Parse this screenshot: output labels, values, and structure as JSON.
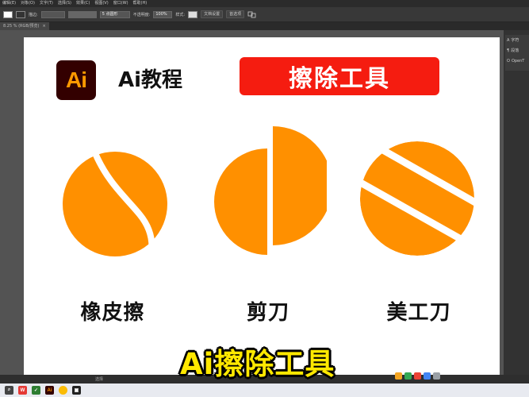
{
  "app": {
    "menu": [
      "编辑(E)",
      "对象(O)",
      "文字(T)",
      "选择(S)",
      "效果(C)",
      "视图(V)",
      "窗口(W)",
      "帮助(H)"
    ],
    "control_bar": {
      "stroke_label": "描边:",
      "stroke_value": "",
      "brush_value": "",
      "points_label": "5 点圆形",
      "opacity_label": "不透明度:",
      "opacity_value": "100%",
      "style_label": "样式:",
      "doc_setup": "文档设置",
      "prefs": "首选项"
    },
    "tab": {
      "label": "8.25 % (RGB/预览)",
      "close": "×"
    },
    "panel": {
      "items": [
        "字符",
        "段落",
        "OpenT"
      ]
    },
    "status": {
      "label": "选择"
    }
  },
  "artwork": {
    "logo_text": "Ai",
    "logo_title": "Ai教程",
    "banner": "擦除工具",
    "captions": [
      "橡皮擦",
      "剪刀",
      "美工刀"
    ]
  },
  "subtitle": "Ai擦除工具",
  "colors": {
    "orange": "#ff9000",
    "banner_red": "#f51c10",
    "logo_bg": "#330000",
    "logo_orange": "#ff9a00",
    "subtitle_yellow": "#ffe800"
  },
  "taskbar": {
    "icons": [
      "search-icon",
      "wps-icon",
      "wechat-icon",
      "illustrator-icon",
      "chrome-icon",
      "app-icon"
    ]
  }
}
